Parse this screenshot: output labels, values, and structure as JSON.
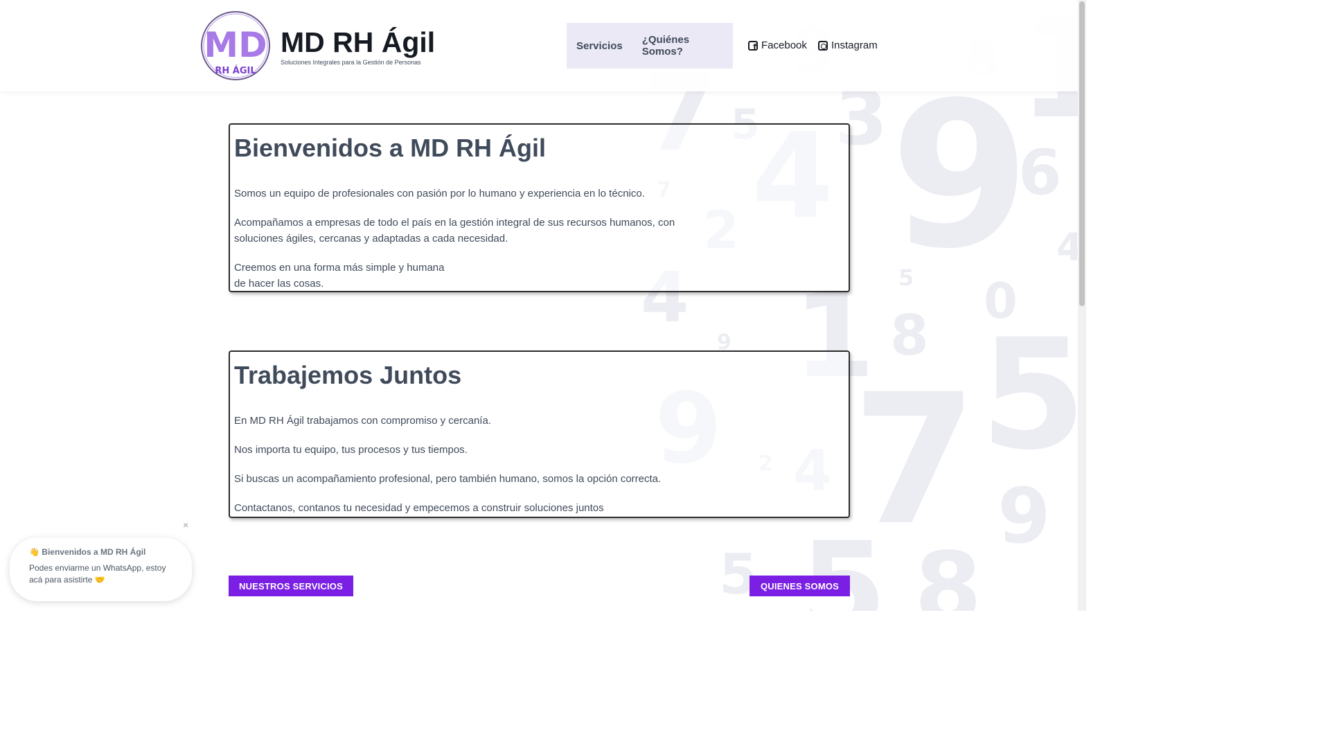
{
  "header": {
    "site_title": "MD RH Ágil",
    "tagline": "Soluciones Integrales para la Gestión de Personas",
    "logo": {
      "monogram": "MD",
      "sub": "RH ÁGIL",
      "icon": "md-rh-agil-logo"
    },
    "nav": [
      {
        "label": "Servicios"
      },
      {
        "label": "¿Quiénes Somos?"
      }
    ],
    "social": [
      {
        "label": "Facebook",
        "icon": "facebook-icon"
      },
      {
        "label": "Instagram",
        "icon": "instagram-icon"
      }
    ]
  },
  "welcome": {
    "heading": "Bienvenidos a MD RH Ágil",
    "p1": "Somos un equipo de profesionales con pasión por lo humano y experiencia en lo técnico.",
    "p2a": "Acompañamos a empresas de todo el país en la gestión integral de sus recursos humanos, con",
    "p2b": "soluciones ágiles, cercanas y adaptadas a cada necesidad.",
    "p3a": "Creemos en una forma más simple y humana",
    "p3b": "de hacer las cosas."
  },
  "together": {
    "heading": "Trabajemos Juntos",
    "p1": "En MD RH Ágil trabajamos con compromiso y cercanía.",
    "p2": "Nos importa tu equipo, tus procesos y tus tiempos.",
    "p3": "Si buscas un acompañamiento profesional, pero también humano, somos la opción correcta.",
    "p4": "Contactanos, contanos tu necesidad y empecemos a construir soluciones juntos"
  },
  "buttons": {
    "services": "NUESTROS SERVICIOS",
    "about": "QUIENES SOMOS"
  },
  "chat": {
    "title_emoji": "👋",
    "title": "Bienvenidos a MD RH Ágil",
    "message": "Podes enviarme un WhatsApp, estoy acá para asistirte",
    "message_emoji": "🤝",
    "close": "×"
  },
  "colors": {
    "accent": "#7a1fe3",
    "nav_bg": "#ebe9f6",
    "text": "#3f4a5a",
    "background_digits": "#ecedf3"
  }
}
